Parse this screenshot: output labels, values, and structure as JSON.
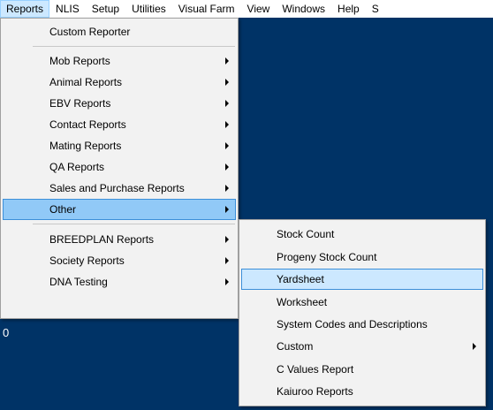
{
  "menubar": {
    "items": [
      "Reports",
      "NLIS",
      "Setup",
      "Utilities",
      "Visual Farm",
      "View",
      "Windows",
      "Help",
      "S"
    ]
  },
  "workspace": {
    "text": "0",
    "background": "#003366"
  },
  "reports_menu": {
    "items": [
      {
        "label": "Custom Reporter",
        "submenu": false
      },
      {
        "label": "Mob Reports",
        "submenu": true
      },
      {
        "label": "Animal Reports",
        "submenu": true
      },
      {
        "label": "EBV Reports",
        "submenu": true
      },
      {
        "label": "Contact Reports",
        "submenu": true
      },
      {
        "label": "Mating Reports",
        "submenu": true
      },
      {
        "label": "QA Reports",
        "submenu": true
      },
      {
        "label": "Sales and Purchase Reports",
        "submenu": true
      },
      {
        "label": "Other",
        "submenu": true,
        "highlighted": true
      },
      {
        "label": "BREEDPLAN Reports",
        "submenu": true
      },
      {
        "label": "Society Reports",
        "submenu": true
      },
      {
        "label": "DNA Testing",
        "submenu": true
      }
    ]
  },
  "other_menu": {
    "items": [
      {
        "label": "Stock Count",
        "submenu": false
      },
      {
        "label": "Progeny Stock Count",
        "submenu": false
      },
      {
        "label": "Yardsheet",
        "submenu": false,
        "highlighted": true
      },
      {
        "label": "Worksheet",
        "submenu": false
      },
      {
        "label": "System Codes and Descriptions",
        "submenu": false
      },
      {
        "label": "Custom",
        "submenu": true
      },
      {
        "label": "C Values Report",
        "submenu": false
      },
      {
        "label": "Kaiuroo Reports",
        "submenu": false
      }
    ]
  },
  "colors": {
    "highlight": "#91c9f7",
    "highlight_border": "#3c8fd9",
    "menu_background": "#f2f2f2"
  }
}
